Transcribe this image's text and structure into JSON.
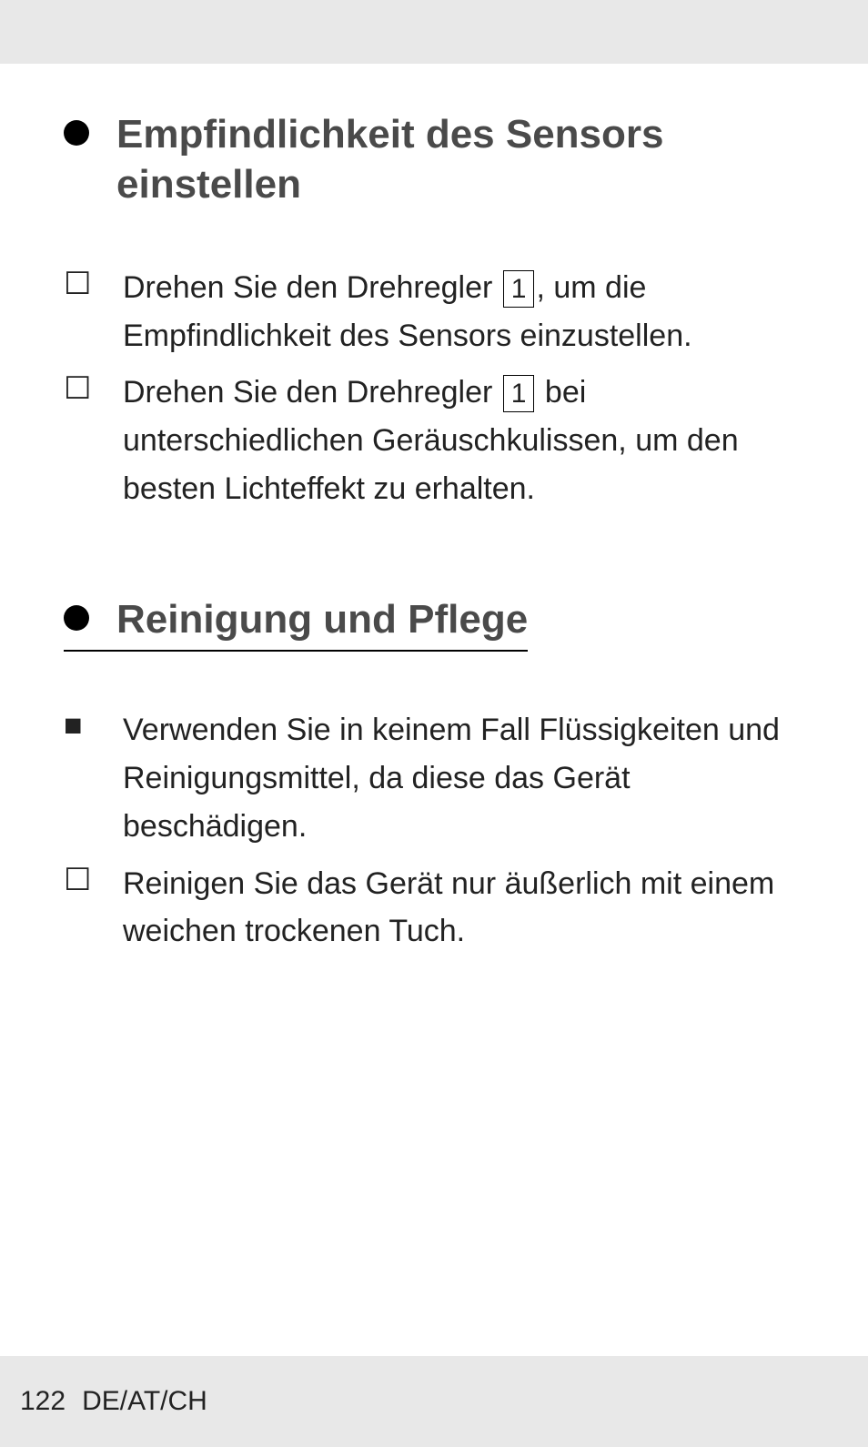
{
  "sections": [
    {
      "heading": "Empfindlichkeit des Sensors einstellen",
      "underlined": false,
      "items": [
        {
          "bullet": "checkbox",
          "text_before": "Drehen Sie den Drehregler ",
          "ref": "1",
          "text_after": ", um die Empfindlichkeit des Sensors einzustellen."
        },
        {
          "bullet": "checkbox",
          "text_before": "Drehen Sie den Drehregler ",
          "ref": "1",
          "text_after": " bei unterschiedlichen Geräusch­kulissen, um den besten Lichteffekt zu erhalten."
        }
      ]
    },
    {
      "heading": "Reinigung und Pflege",
      "underlined": true,
      "items": [
        {
          "bullet": "square",
          "text_before": "Verwenden Sie in keinem Fall Flüssigkeiten und Reinigungsmittel, da diese das Gerät beschädigen.",
          "ref": null,
          "text_after": ""
        },
        {
          "bullet": "checkbox",
          "text_before": "Reinigen Sie das Gerät nur äußer­lich mit einem weichen trockenen Tuch.",
          "ref": null,
          "text_after": ""
        }
      ]
    }
  ],
  "footer": {
    "page": "122",
    "lang": "DE/AT/CH"
  }
}
